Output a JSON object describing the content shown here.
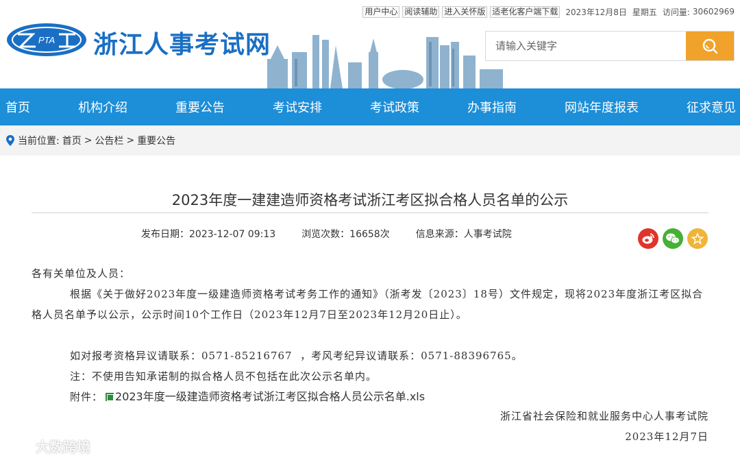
{
  "topbar": {
    "links": [
      "用户中心",
      "阅读辅助",
      "进入关怀版",
      "适老化客户端下载"
    ],
    "date": "2023年12月8日",
    "weekday": "星期五",
    "visits_label": "访问量:",
    "visits": "30602969"
  },
  "header": {
    "logo_text": "PTA",
    "site_name": "浙江人事考试网",
    "search_placeholder": "请输入关键字"
  },
  "nav": {
    "items": [
      "首页",
      "机构介绍",
      "重要公告",
      "考试安排",
      "考试政策",
      "办事指南",
      "网站年度报表",
      "征求意见"
    ]
  },
  "breadcrumb": {
    "label": "当前位置:",
    "items": [
      "首页",
      "公告栏",
      "重要公告"
    ],
    "sep": ">"
  },
  "article": {
    "title": "2023年度一建建造师资格考试浙江考区拟合格人员名单的公示",
    "publish": "发布日期：2023-12-07 09:13",
    "views": "浏览次数：16658次",
    "source": "信息来源：人事考试院",
    "salutation": "各有关单位及人员：",
    "para1": "根据《关于做好2023年度一级建造师资格考试考务工作的通知》（浙考发〔2023〕18号）文件规定，现将2023年度浙江考区拟合格人员名单予以公示，公示时间10个工作日（2023年12月7日至2023年12月20日止）。",
    "contact": "如对报考资格异议请联系：0571-85216767  ，考风考纪异议请联系：0571-88396765。",
    "note": "注：不使用告知承诺制的拟合格人员不包括在此次公示名单内。",
    "attach_label": "附件：",
    "attach_name": "2023年度一级建造师资格考试浙江考区拟合格人员公示名单.xls",
    "signature": "浙江省社会保险和就业服务中心人事考试院",
    "sign_date": "2023年12月7日"
  },
  "watermark": "大数跨境",
  "colors": {
    "brand_blue": "#1d8ed8",
    "search_orange": "#f0a22a",
    "weibo_red": "#e0352b",
    "wechat_green": "#46b035",
    "fav_yellow": "#f0b43a"
  }
}
